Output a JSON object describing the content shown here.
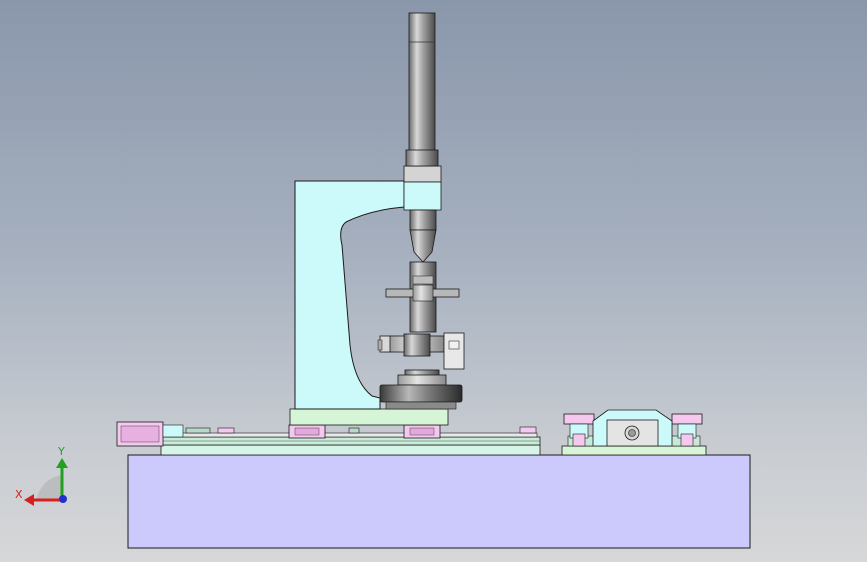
{
  "viewport": {
    "background_top": "#8a97ab",
    "background_bottom": "#d6d7d8"
  },
  "model": {
    "colors": {
      "base_block": "#cccafc",
      "frame": "#ccfafa",
      "press_shaft": "#9a9a9a",
      "base_plate": "#d6f5d6",
      "pink_part": "#f5c8f0",
      "outline": "#1a1a1a"
    }
  },
  "triad": {
    "x_label": "X",
    "y_label": "Y",
    "x_color": "#d42020",
    "y_color": "#22a022",
    "z_color": "#2030d0"
  }
}
